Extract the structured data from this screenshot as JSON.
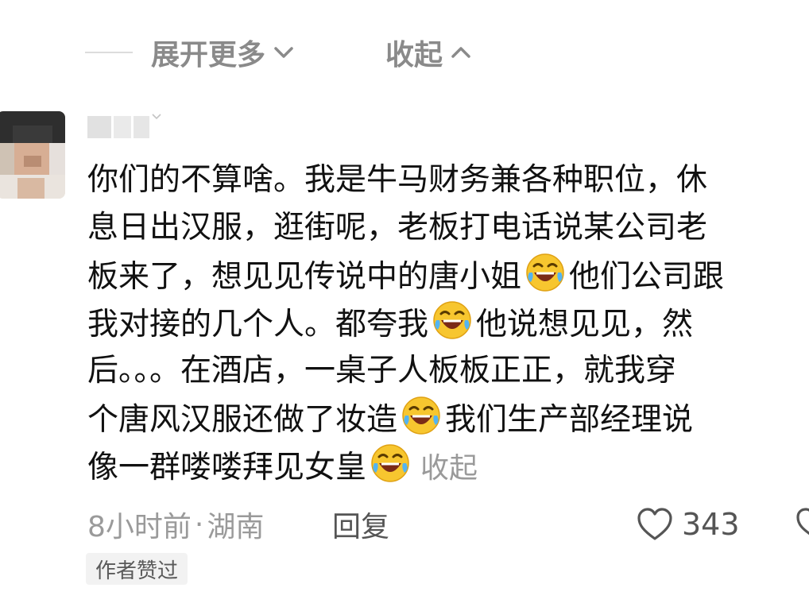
{
  "thread_controls": {
    "expand_more_label": "展开更多",
    "collapse_label": "收起"
  },
  "comment": {
    "lines": [
      "你们的不算啥。我是牛马财务兼各种职位，休",
      "息日出汉服，逛街呢，老板打电话说某公司老",
      "板来了，想见见传说中的唐小姐",
      "他们公司跟",
      "我对接的几个人。都夸我",
      "他说想见见，然",
      "后。。。在酒店，一桌子人板板正正，就我穿",
      "个唐风汉服还做了妆造",
      "我们生产部经理说",
      "像一群喽喽拜见女皇"
    ],
    "inline_collapse_label": "收起",
    "emoji_name": "rolling-on-floor-laughing-emoji",
    "time": "8小时前",
    "location_separator": "·",
    "location": "湖南",
    "reply_label": "回复",
    "like_count": "343",
    "author_badge": "作者赞过"
  },
  "icons": {
    "like": "heart-outline-icon",
    "expand": "chevron-down-icon",
    "collapse": "chevron-up-icon"
  },
  "colors": {
    "muted_text": "#9a9a9a",
    "body_text": "#111111",
    "emoji_face": "#f7c62f"
  }
}
